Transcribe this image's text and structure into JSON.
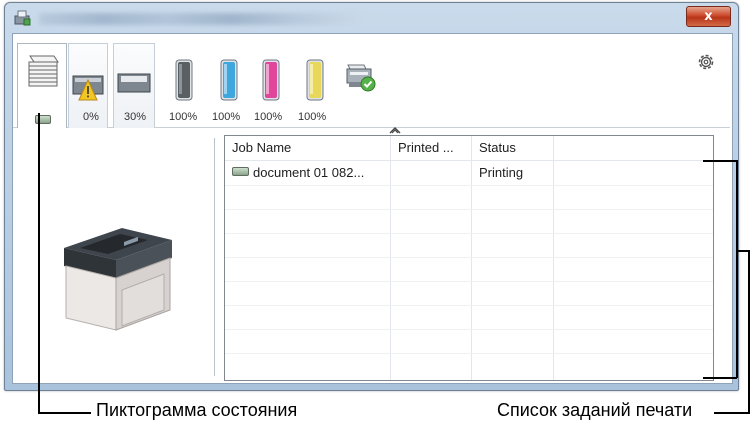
{
  "window": {
    "close_label": "x"
  },
  "toolbar": {
    "tabs": [
      {
        "name": "status-tab",
        "percent": ""
      },
      {
        "name": "paper-warning-tab",
        "percent": "0%"
      },
      {
        "name": "paper-tray-tab",
        "percent": "30%"
      },
      {
        "name": "toner-black-tab",
        "percent": "100%"
      },
      {
        "name": "toner-cyan-tab",
        "percent": "100%"
      },
      {
        "name": "toner-magenta-tab",
        "percent": "100%"
      },
      {
        "name": "toner-yellow-tab",
        "percent": "100%"
      },
      {
        "name": "device-ok-tab",
        "percent": ""
      }
    ],
    "toner_colors": [
      "#5a5f63",
      "#3fa6de",
      "#e0479b",
      "#e8d85a"
    ],
    "icons": [
      "gear-icon",
      "collapse-icon"
    ]
  },
  "job_list": {
    "columns": [
      "Job Name",
      "Printed ...",
      "Status"
    ],
    "rows": [
      {
        "name": "document 01 082...",
        "printed": "",
        "status": "Printing"
      }
    ]
  },
  "callouts": {
    "status_icon_label": "Пиктограмма состояния",
    "job_list_label": "Список заданий печати"
  }
}
